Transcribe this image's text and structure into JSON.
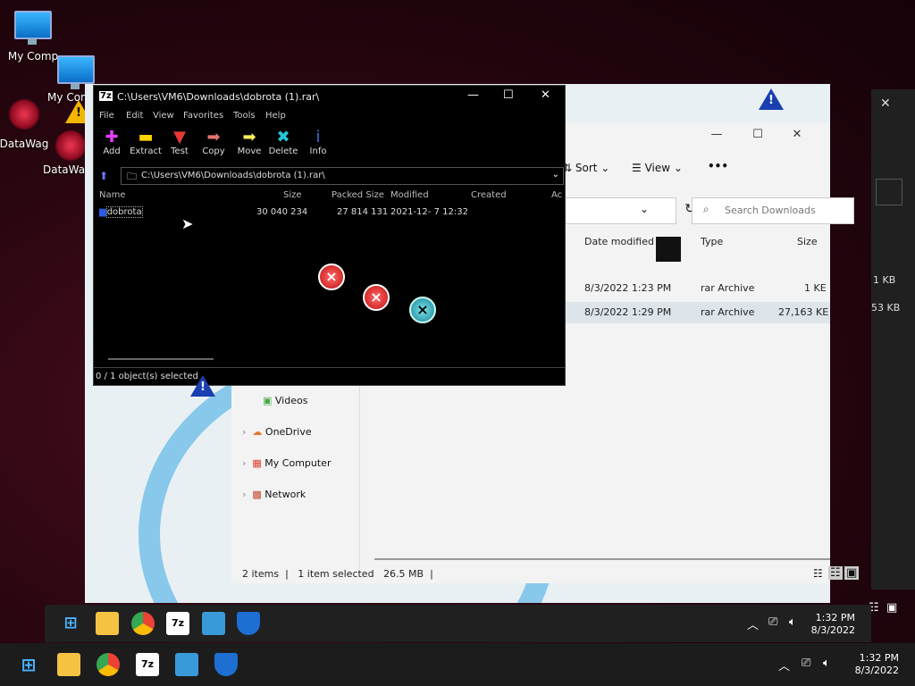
{
  "desktop": {
    "icons": [
      {
        "label": "My Comp"
      },
      {
        "label": "My Compu"
      },
      {
        "label": "DataWag"
      },
      {
        "label": "DataWago"
      }
    ]
  },
  "sevenzip": {
    "title": "C:\\Users\\VM6\\Downloads\\dobrota (1).rar\\",
    "menu": [
      "File",
      "Edit",
      "View",
      "Favorites",
      "Tools",
      "Help"
    ],
    "toolbar": [
      "Add",
      "Extract",
      "Test",
      "Copy",
      "Move",
      "Delete",
      "Info"
    ],
    "path": "C:\\Users\\VM6\\Downloads\\dobrota (1).rar\\",
    "columns": [
      "Name",
      "Size",
      "Packed Size",
      "Modified",
      "Created",
      "Ac"
    ],
    "row": {
      "name": "dobrota",
      "size": "30 040 234",
      "packed": "27 814 131",
      "modified": "2021-12- 7 12:32"
    },
    "status": "0 / 1 object(s) selected"
  },
  "explorer": {
    "toolbar": {
      "sort": "Sort",
      "view": "View",
      "more": "•••"
    },
    "search_placeholder": "Search Downloads",
    "columns": {
      "date": "Date modified",
      "type": "Type",
      "size": "Size"
    },
    "rows": [
      {
        "date": "8/3/2022 1:23 PM",
        "type": "rar Archive",
        "size": "1 KE"
      },
      {
        "date": "8/3/2022 1:29 PM",
        "type": "rar Archive",
        "size": "27,163 KE"
      }
    ],
    "nav": [
      {
        "label": "Videos"
      },
      {
        "label": "OneDrive"
      },
      {
        "label": "My Computer"
      },
      {
        "label": "Network"
      }
    ],
    "status": {
      "items": "2 items",
      "selected": "1 item selected",
      "size": "26.5 MB"
    }
  },
  "dark_window": {
    "size1": "1 KB",
    "size2": "53 KB"
  },
  "taskbar": {
    "time": "1:32 PM",
    "date": "8/3/2022",
    "ghost_time": "1:32 PM",
    "ghost_date": "8/3/2022",
    "seven_label": "7z"
  },
  "colors": {
    "accent": "#0a6fc7",
    "taskbar": "#1c1c1c"
  }
}
